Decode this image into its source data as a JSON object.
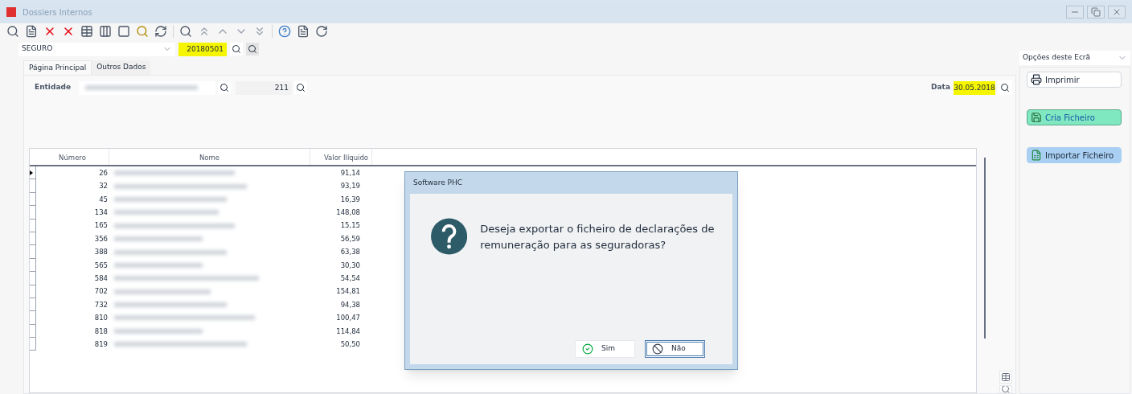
{
  "window": {
    "title": "Dossiers Internos"
  },
  "filter": {
    "type_value": "SEGURO",
    "code_value": "20180501"
  },
  "tabs": [
    {
      "label": "Página Principal",
      "selected": true
    },
    {
      "label": "Outros Dados",
      "selected": false
    }
  ],
  "entity": {
    "label": "Entidade",
    "number": "211"
  },
  "date": {
    "label": "Data",
    "value": "30.05.2018"
  },
  "table": {
    "columns": [
      "Número",
      "Nome",
      "Valor Ilíquido"
    ],
    "rows": [
      {
        "number": "26",
        "value": "91,14",
        "selected": true
      },
      {
        "number": "32",
        "value": "93,19",
        "selected": false
      },
      {
        "number": "45",
        "value": "16,39",
        "selected": false
      },
      {
        "number": "134",
        "value": "148,08",
        "selected": false
      },
      {
        "number": "165",
        "value": "15,15",
        "selected": false
      },
      {
        "number": "356",
        "value": "56,59",
        "selected": false
      },
      {
        "number": "388",
        "value": "63,38",
        "selected": false
      },
      {
        "number": "565",
        "value": "30,30",
        "selected": false
      },
      {
        "number": "584",
        "value": "54,54",
        "selected": false
      },
      {
        "number": "702",
        "value": "154,81",
        "selected": false
      },
      {
        "number": "732",
        "value": "94,38",
        "selected": false
      },
      {
        "number": "810",
        "value": "100,47",
        "selected": false
      },
      {
        "number": "818",
        "value": "114,84",
        "selected": false
      },
      {
        "number": "819",
        "value": "50,50",
        "selected": false
      }
    ]
  },
  "side_panel": {
    "dropdown": "Opções deste Ecrã",
    "buttons": [
      {
        "kind": "print",
        "label": "Imprimir"
      },
      {
        "kind": "create",
        "label": "Cria Ficheiro"
      },
      {
        "kind": "import",
        "label": "Importar Ficheiro"
      }
    ]
  },
  "dialog": {
    "title": "Software PHC",
    "message": "Deseja exportar o ficheiro de declarações de remuneração para as seguradoras?",
    "buttons": [
      {
        "kind": "yes",
        "label": "Sim",
        "selected": false
      },
      {
        "kind": "no",
        "label": "Não",
        "selected": true
      }
    ]
  }
}
